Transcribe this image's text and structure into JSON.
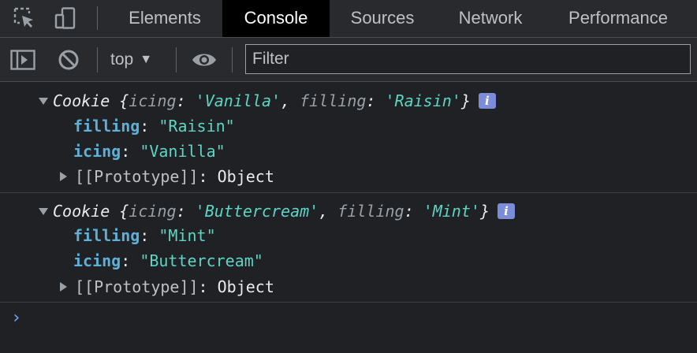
{
  "devtools": {
    "tabs": [
      {
        "label": "Elements"
      },
      {
        "label": "Console",
        "active": true
      },
      {
        "label": "Sources"
      },
      {
        "label": "Network"
      },
      {
        "label": "Performance"
      }
    ],
    "icons": {
      "inspect": "inspect-element-icon",
      "device": "device-toolbar-icon"
    }
  },
  "console_toolbar": {
    "context": "top",
    "filter_placeholder": "Filter",
    "filter_value": ""
  },
  "messages": [
    {
      "class_name": "Cookie",
      "preview": [
        {
          "key": "icing",
          "value": "'Vanilla'"
        },
        {
          "key": "filling",
          "value": "'Raisin'"
        }
      ],
      "properties": [
        {
          "key": "filling",
          "value": "\"Raisin\""
        },
        {
          "key": "icing",
          "value": "\"Vanilla\""
        }
      ],
      "prototype_label": "[[Prototype]]",
      "prototype_value": "Object",
      "info_badge": "i"
    },
    {
      "class_name": "Cookie",
      "preview": [
        {
          "key": "icing",
          "value": "'Buttercream'"
        },
        {
          "key": "filling",
          "value": "'Mint'"
        }
      ],
      "properties": [
        {
          "key": "filling",
          "value": "\"Mint\""
        },
        {
          "key": "icing",
          "value": "\"Buttercream\""
        }
      ],
      "prototype_label": "[[Prototype]]",
      "prototype_value": "Object",
      "info_badge": "i"
    }
  ],
  "prompt_symbol": "›",
  "colors": {
    "background": "#202124",
    "toolbar": "#292a2d",
    "property_key": "#5db0d7",
    "string_value": "#5cd5c5",
    "info_badge": "#7b8dd8",
    "prompt": "#6ea6f7"
  }
}
